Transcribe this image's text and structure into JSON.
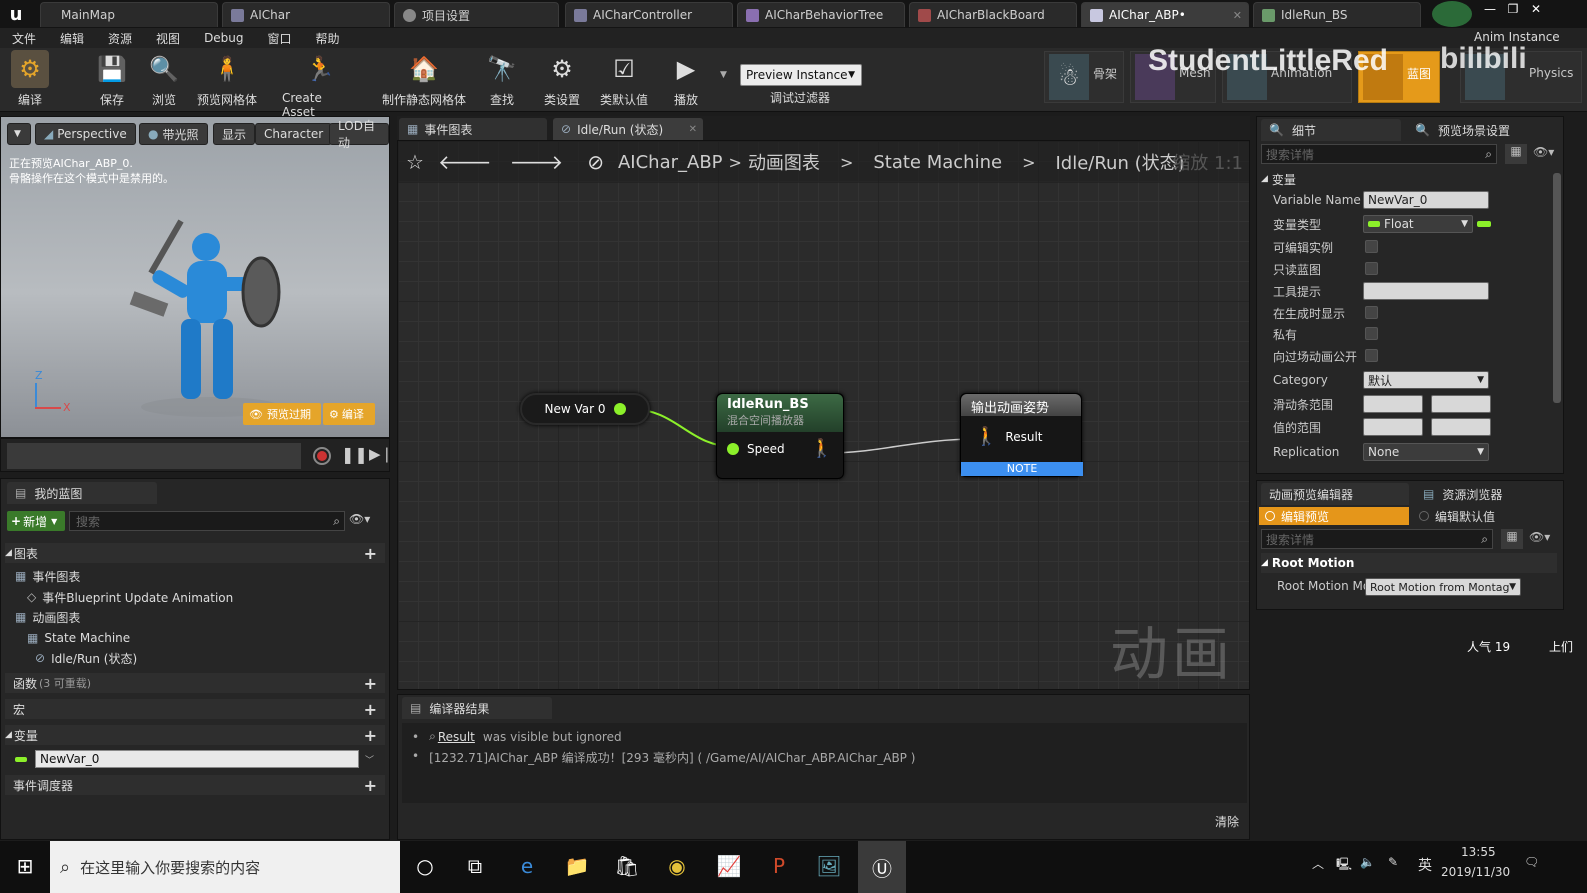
{
  "tabs": [
    {
      "label": "MainMap"
    },
    {
      "label": "AIChar"
    },
    {
      "label": "项目设置"
    },
    {
      "label": "AICharController"
    },
    {
      "label": "AICharBehaviorTree"
    },
    {
      "label": "AICharBlackBoard"
    },
    {
      "label": "AIChar_ABP•"
    },
    {
      "label": "IdleRun_BS"
    }
  ],
  "menu": [
    "文件",
    "编辑",
    "资源",
    "视图",
    "Debug",
    "窗口",
    "帮助"
  ],
  "toolbar": {
    "buttons": [
      "编译",
      "保存",
      "浏览",
      "预览网格体",
      "Create Asset",
      "制作静态网格体",
      "查找",
      "类设置",
      "类默认值",
      "播放"
    ],
    "preview_instance": "Preview Instance",
    "debug_filter": "调试过滤器",
    "modes": [
      "骨架",
      "Mesh",
      "Animation",
      "蓝图",
      "Physics"
    ],
    "anim_instance": "Anim Instance"
  },
  "watermark": {
    "text": "StudentLittleRed",
    "sub": "bilibili",
    "overlay": "动画",
    "popularity": "人气 19",
    "truncated": "上们"
  },
  "viewport": {
    "btns": [
      "Perspective",
      "带光照",
      "显示",
      "Character",
      "LOD自动"
    ],
    "msg1": "正在预览AIChar_ABP_0.",
    "msg2": "骨骼操作在这个模式中是禁用的。",
    "axis_z": "Z",
    "axis_x": "X",
    "preview_expired": "预览过期",
    "compile": "编译"
  },
  "my_blueprint": {
    "title": "我的蓝图",
    "new_btn": "新增",
    "search_placeholder": "搜索",
    "graphs": "图表",
    "event_graph": "事件图表",
    "event_item": "事件Blueprint Update Animation",
    "anim_graph": "动画图表",
    "state_machine": "State Machine",
    "idle_run": "Idle/Run (状态)",
    "functions": "函数",
    "functions_count": "(3 可重载)",
    "macros": "宏",
    "variables": "变量",
    "var_name": "NewVar_0",
    "dispatchers": "事件调度器"
  },
  "graph": {
    "tab1": "事件图表",
    "tab2": "Idle/Run (状态)",
    "breadcrumb": [
      "AIChar_ABP",
      "动画图表",
      "State Machine",
      "Idle/Run (状态)"
    ],
    "zoom": "缩放 1:1",
    "var_node": "New Var 0",
    "bs_title": "IdleRun_BS",
    "bs_sub": "混合空间播放器",
    "bs_pin": "Speed",
    "out_title": "输出动画姿势",
    "out_pin": "Result",
    "note": "NOTE"
  },
  "compiler": {
    "tab": "编译器结果",
    "line1_key": "Result",
    "line1_rest": "was visible but ignored",
    "line2": "[1232.71]AIChar_ABP 编译成功！[293 毫秒内] ( /Game/AI/AIChar_ABP.AIChar_ABP )",
    "clear": "清除"
  },
  "details": {
    "tab": "细节",
    "tab2": "预览场景设置",
    "search_placeholder": "搜索详情",
    "section": "变量",
    "rows": [
      {
        "label": "Variable Name",
        "value": "NewVar_0"
      },
      {
        "label": "变量类型",
        "value": "Float"
      },
      {
        "label": "可编辑实例"
      },
      {
        "label": "只读蓝图"
      },
      {
        "label": "工具提示"
      },
      {
        "label": "在生成时显示"
      },
      {
        "label": "私有"
      },
      {
        "label": "向过场动画公开"
      },
      {
        "label": "Category",
        "value": "默认"
      },
      {
        "label": "滑动条范围"
      },
      {
        "label": "值的范围"
      },
      {
        "label": "Replication",
        "value": "None"
      }
    ]
  },
  "anim_preview": {
    "tab": "动画预览编辑器",
    "tab2": "资源浏览器",
    "edit_preview": "编辑预览",
    "edit_defaults": "编辑默认值",
    "search_placeholder": "搜索详情",
    "section": "Root Motion",
    "row_label": "Root Motion Mo",
    "row_value": "Root Motion from Montag"
  },
  "taskbar": {
    "search": "在这里输入你要搜索的内容",
    "lang": "英",
    "time": "13:55",
    "date": "2019/11/30"
  },
  "colors": {
    "accent": "#e59a1a",
    "note": "#3c8ff0",
    "pin_green": "#8cf02a",
    "bs_header": "#2e5a3a"
  }
}
